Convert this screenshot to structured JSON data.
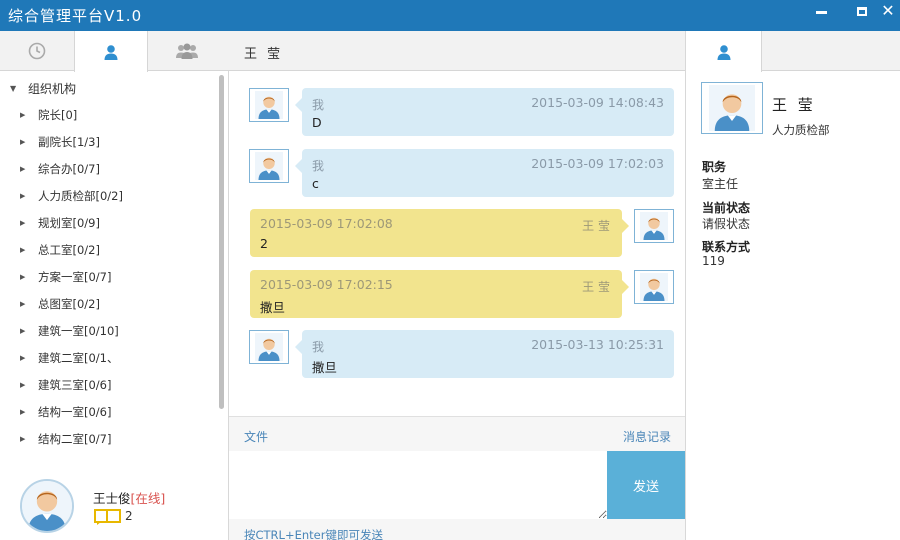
{
  "window": {
    "title": "综合管理平台V1.0",
    "controls": [
      "minimize-icon",
      "maximize-icon",
      "close-icon"
    ]
  },
  "left_panel": {
    "tabs": [
      {
        "icon": "clock-icon",
        "label": ""
      },
      {
        "icon": "user-icon",
        "label": "",
        "active": true
      },
      {
        "icon": "group-icon",
        "label": ""
      }
    ],
    "tree": {
      "root": "组织机构",
      "items": [
        "院长[0]",
        "副院长[1/3]",
        "综合办[0/7]",
        "人力质检部[0/2]",
        "规划室[0/9]",
        "总工室[0/2]",
        "方案一室[0/7]",
        "总图室[0/2]",
        "建筑一室[0/10]",
        "建筑二室[0/1、",
        "建筑三室[0/6]",
        "结构一室[0/6]",
        "结构二室[0/7]"
      ]
    },
    "me": {
      "name": "王士俊",
      "status": "[在线]",
      "message_count": "2"
    }
  },
  "chat": {
    "contact_name": "王 莹",
    "messages": [
      {
        "side": "left",
        "sender": "我",
        "time": "2015-03-09 14:08:43",
        "text": "D"
      },
      {
        "side": "left",
        "sender": "我",
        "time": "2015-03-09 17:02:03",
        "text": "c"
      },
      {
        "side": "right",
        "sender": "王 莹",
        "time": "2015-03-09 17:02:08",
        "text": "2"
      },
      {
        "side": "right",
        "sender": "王 莹",
        "time": "2015-03-09 17:02:15",
        "text": "撒旦"
      },
      {
        "side": "left",
        "sender": "我",
        "time": "2015-03-13 10:25:31",
        "text": "撒旦"
      }
    ],
    "toolbar": {
      "file_label": "文件",
      "history_label": "消息记录"
    },
    "input_value": "",
    "send_label": "发送",
    "hint": "按CTRL+Enter键即可发送"
  },
  "profile": {
    "name": "王 莹",
    "department": "人力质检部",
    "fields": [
      {
        "label": "职务",
        "value": "室主任"
      },
      {
        "label": "当前状态",
        "value": "请假状态"
      },
      {
        "label": "联系方式",
        "value": "119"
      }
    ]
  },
  "colors": {
    "titlebar": "#1f78b8",
    "my_bubble": "#d7ebf6",
    "their_bubble": "#f2e48e",
    "send_button": "#5ab0d8",
    "link": "#4a86b8",
    "online": "#d9534f"
  }
}
